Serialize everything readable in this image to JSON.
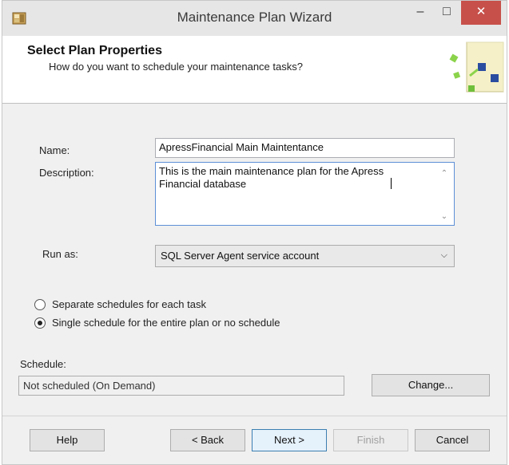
{
  "window": {
    "title": "Maintenance Plan Wizard",
    "minimize_glyph": "–",
    "maximize_glyph": "□",
    "close_glyph": "✕"
  },
  "header": {
    "title": "Select Plan Properties",
    "subtitle": "How do you want to schedule your maintenance tasks?"
  },
  "form": {
    "name_label": "Name:",
    "name_value": "ApressFinancial Main Maintentance",
    "description_label": "Description:",
    "description_value": "This is the main maintenance plan for the Apress Financial database",
    "run_as_label": "Run as:",
    "run_as_value": "SQL Server Agent service account",
    "schedule_options": [
      {
        "label": "Separate schedules for each task",
        "selected": false
      },
      {
        "label": "Single schedule for the entire plan or no schedule",
        "selected": true
      }
    ],
    "schedule_label": "Schedule:",
    "schedule_value": "Not scheduled (On Demand)",
    "change_button": "Change..."
  },
  "footer": {
    "help": "Help",
    "back": "< Back",
    "next": "Next >",
    "finish": "Finish",
    "cancel": "Cancel"
  },
  "colors": {
    "close_button": "#c7504a",
    "focus_border": "#5c8fd6"
  }
}
